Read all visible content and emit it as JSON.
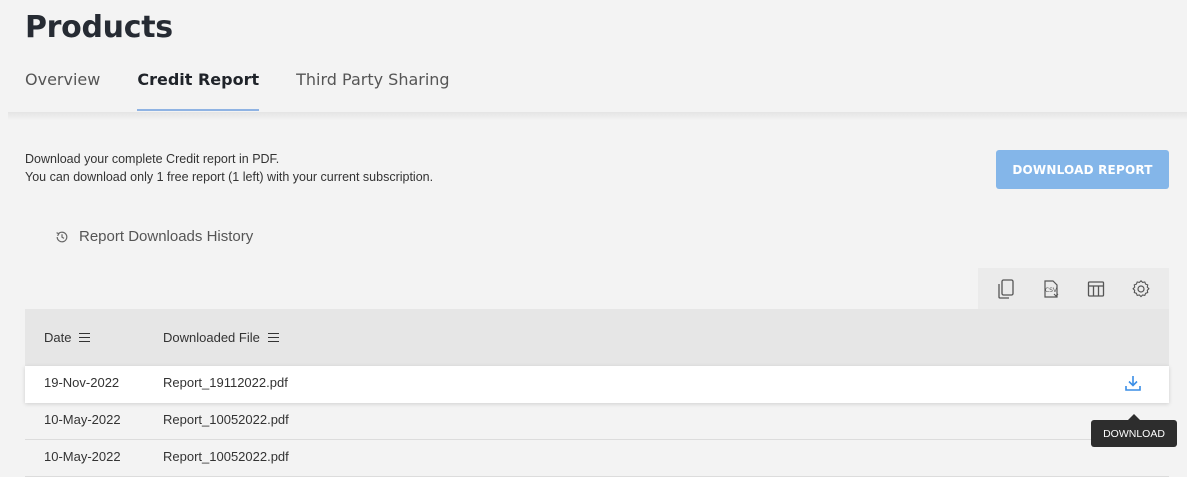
{
  "page": {
    "title": "Products"
  },
  "tabs": [
    {
      "label": "Overview",
      "active": false
    },
    {
      "label": "Credit Report",
      "active": true
    },
    {
      "label": "Third Party Sharing",
      "active": false
    }
  ],
  "description": {
    "line1": "Download your complete Credit report in PDF.",
    "line2": "You can download only 1 free report (1 left) with your current subscription."
  },
  "download_report_button": {
    "label": "DOWNLOAD REPORT",
    "color": "#84b6e9"
  },
  "history_link": {
    "label": "Report Downloads History",
    "icon": "history-icon"
  },
  "toolbar": {
    "icons": [
      "copy-icon",
      "csv-export-icon",
      "columns-icon",
      "settings-icon"
    ]
  },
  "table": {
    "columns": [
      "Date",
      "Downloaded File"
    ],
    "rows": [
      {
        "date": "19-Nov-2022",
        "file": "Report_19112022.pdf"
      },
      {
        "date": "10-May-2022",
        "file": "Report_10052022.pdf"
      },
      {
        "date": "10-May-2022",
        "file": "Report_10052022.pdf"
      }
    ]
  },
  "tooltip": {
    "text": "DOWNLOAD"
  },
  "colors": {
    "accent": "#84b6e9",
    "download_icon": "#3a8ee6"
  }
}
